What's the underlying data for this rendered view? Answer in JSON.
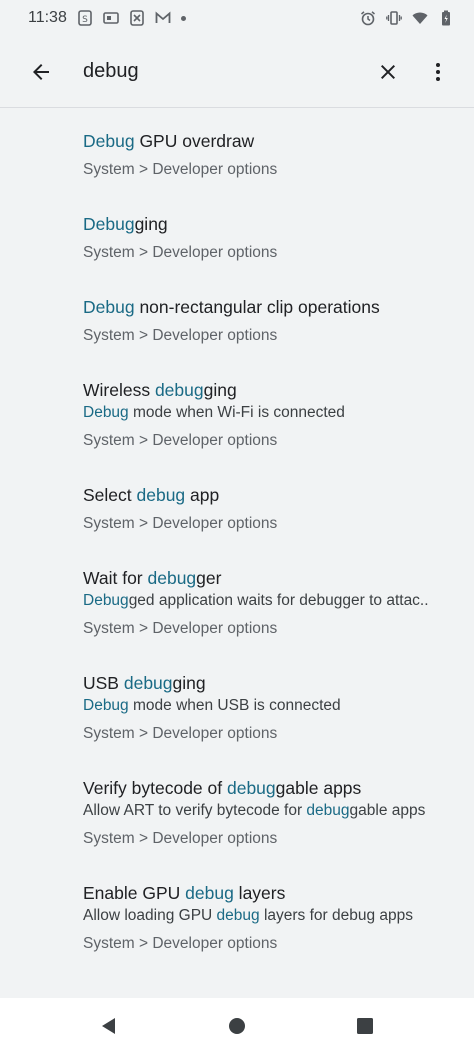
{
  "status_bar": {
    "time": "11:38",
    "left_icons": [
      "s-notification-icon",
      "tablet-notification-icon",
      "x-box-notification-icon",
      "gmail-icon",
      "more-notifications-dot-icon"
    ],
    "right_icons": [
      "alarm-icon",
      "vibrate-icon",
      "wifi-icon",
      "battery-icon"
    ]
  },
  "toolbar": {
    "query": "debug",
    "icons": {
      "back": "back-arrow-icon",
      "clear": "close-icon",
      "more": "more-vert-icon"
    }
  },
  "results": [
    {
      "title_parts": [
        {
          "t": "Debug",
          "hl": true
        },
        {
          "t": " GPU overdraw",
          "hl": false
        }
      ],
      "summary_parts": [],
      "breadcrumb": "System > Developer options"
    },
    {
      "title_parts": [
        {
          "t": "Debug",
          "hl": true
        },
        {
          "t": "ging",
          "hl": false
        }
      ],
      "summary_parts": [],
      "breadcrumb": "System > Developer options"
    },
    {
      "title_parts": [
        {
          "t": "Debug",
          "hl": true
        },
        {
          "t": " non-rectangular clip operations",
          "hl": false
        }
      ],
      "summary_parts": [],
      "breadcrumb": "System > Developer options"
    },
    {
      "title_parts": [
        {
          "t": "Wireless ",
          "hl": false
        },
        {
          "t": "debug",
          "hl": true
        },
        {
          "t": "ging",
          "hl": false
        }
      ],
      "summary_parts": [
        {
          "t": "Debug",
          "hl": true
        },
        {
          "t": " mode when Wi-Fi is connected",
          "hl": false
        }
      ],
      "breadcrumb": "System > Developer options"
    },
    {
      "title_parts": [
        {
          "t": "Select ",
          "hl": false
        },
        {
          "t": "debug",
          "hl": true
        },
        {
          "t": " app",
          "hl": false
        }
      ],
      "summary_parts": [],
      "breadcrumb": "System > Developer options"
    },
    {
      "title_parts": [
        {
          "t": "Wait for ",
          "hl": false
        },
        {
          "t": "debug",
          "hl": true
        },
        {
          "t": "ger",
          "hl": false
        }
      ],
      "summary_parts": [
        {
          "t": "Debug",
          "hl": true
        },
        {
          "t": "ged application waits for debugger to attac..",
          "hl": false
        }
      ],
      "breadcrumb": "System > Developer options"
    },
    {
      "title_parts": [
        {
          "t": "USB ",
          "hl": false
        },
        {
          "t": "debug",
          "hl": true
        },
        {
          "t": "ging",
          "hl": false
        }
      ],
      "summary_parts": [
        {
          "t": "Debug",
          "hl": true
        },
        {
          "t": " mode when USB is connected",
          "hl": false
        }
      ],
      "breadcrumb": "System > Developer options"
    },
    {
      "title_parts": [
        {
          "t": "Verify bytecode of ",
          "hl": false
        },
        {
          "t": "debug",
          "hl": true
        },
        {
          "t": "gable apps",
          "hl": false
        }
      ],
      "summary_parts": [
        {
          "t": "Allow ART to verify bytecode for ",
          "hl": false
        },
        {
          "t": "debug",
          "hl": true
        },
        {
          "t": "gable apps",
          "hl": false
        }
      ],
      "breadcrumb": "System > Developer options"
    },
    {
      "title_parts": [
        {
          "t": "Enable GPU ",
          "hl": false
        },
        {
          "t": "debug",
          "hl": true
        },
        {
          "t": " layers",
          "hl": false
        }
      ],
      "summary_parts": [
        {
          "t": "Allow loading GPU ",
          "hl": false
        },
        {
          "t": "debug",
          "hl": true
        },
        {
          "t": " layers for debug apps",
          "hl": false
        }
      ],
      "breadcrumb": "System > Developer options"
    }
  ],
  "nav_bar": {
    "icons": [
      "back-triangle-icon",
      "home-circle-icon",
      "recents-square-icon"
    ]
  },
  "colors": {
    "highlight": "#1a6a85",
    "background": "#f1f3f4",
    "nav_background": "#ffffff"
  }
}
